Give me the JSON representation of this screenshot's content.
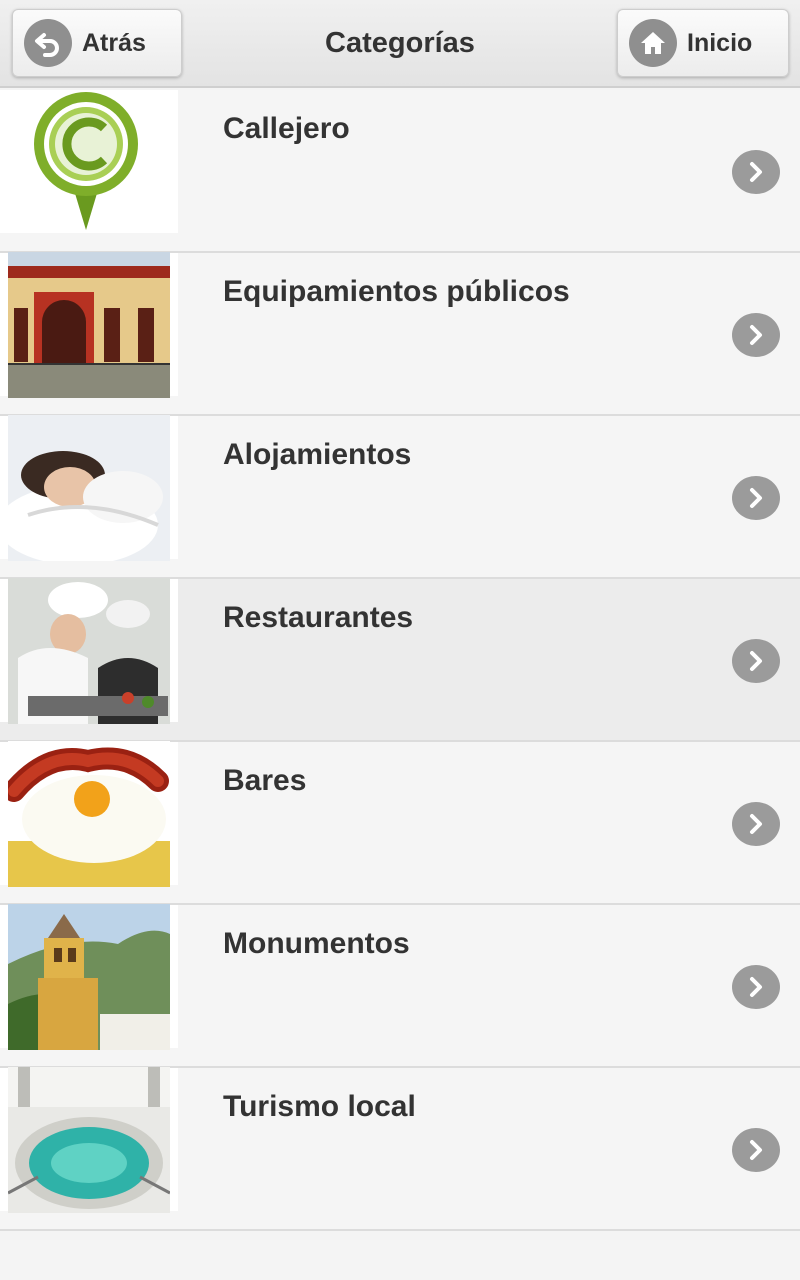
{
  "header": {
    "title": "Categorías",
    "back_label": "Atrás",
    "home_label": "Inicio",
    "back_icon": "back-arrow-icon",
    "home_icon": "home-icon"
  },
  "categories": [
    {
      "label": "Callejero",
      "thumbnail": "map-pin-c-logo"
    },
    {
      "label": "Equipamientos públicos",
      "thumbnail": "building-photo"
    },
    {
      "label": "Alojamientos",
      "thumbnail": "sleeping-woman-photo"
    },
    {
      "label": "Restaurantes",
      "thumbnail": "chefs-photo"
    },
    {
      "label": "Bares",
      "thumbnail": "fried-egg-chorizo-photo"
    },
    {
      "label": "Monumentos",
      "thumbnail": "tower-photo"
    },
    {
      "label": "Turismo local",
      "thumbnail": "spa-pool-photo"
    }
  ],
  "colors": {
    "header_bg": "#e8e8e8",
    "row_bg": "#f5f5f5",
    "active_row_bg": "#ececec",
    "text": "#333333",
    "chevron_bg": "#9b9b9b"
  }
}
